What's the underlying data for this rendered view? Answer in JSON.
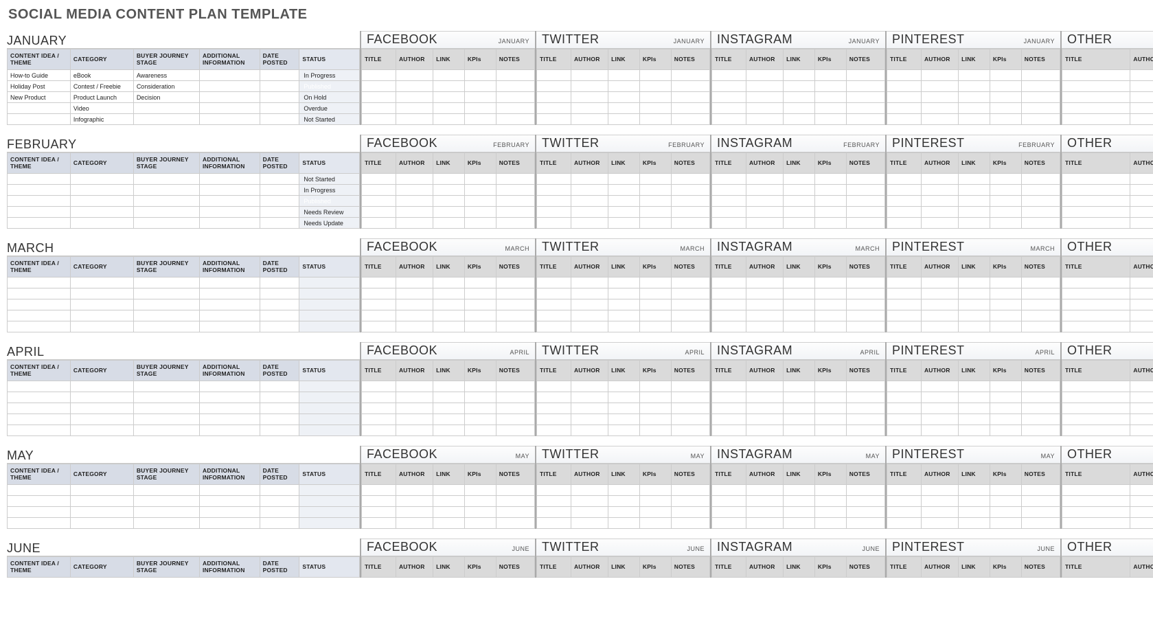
{
  "page_title": "SOCIAL MEDIA CONTENT PLAN TEMPLATE",
  "plan_headers": [
    "CONTENT IDEA / THEME",
    "CATEGORY",
    "BUYER JOURNEY STAGE",
    "ADDITIONAL INFORMATION",
    "DATE POSTED",
    "STATUS"
  ],
  "platform_headers": [
    "TITLE",
    "AUTHOR",
    "LINK",
    "KPIs",
    "NOTES"
  ],
  "platforms": [
    "FACEBOOK",
    "TWITTER",
    "INSTAGRAM",
    "PINTEREST",
    "OTHER"
  ],
  "status_styles": {
    "In Progress": "st-inprogress",
    "Published": "st-published",
    "On Hold": "st-onhold",
    "Overdue": "st-overdue",
    "Not Started": "st-notstarted",
    "Needs Review": "st-needsreview",
    "Needs Update": "st-needsupdate"
  },
  "months": [
    {
      "name": "JANUARY",
      "rows": [
        {
          "idea": "How-to Guide",
          "category": "eBook",
          "stage": "Awareness",
          "info": "",
          "date": "",
          "status": "In Progress"
        },
        {
          "idea": "Holiday Post",
          "category": "Contest / Freebie",
          "stage": "Consideration",
          "info": "",
          "date": "",
          "status": "Published"
        },
        {
          "idea": "New Product",
          "category": "Product Launch",
          "stage": "Decision",
          "info": "",
          "date": "",
          "status": "On Hold"
        },
        {
          "idea": "",
          "category": "Video",
          "stage": "",
          "info": "",
          "date": "",
          "status": "Overdue"
        },
        {
          "idea": "",
          "category": "Infographic",
          "stage": "",
          "info": "",
          "date": "",
          "status": "Not Started"
        }
      ]
    },
    {
      "name": "FEBRUARY",
      "rows": [
        {
          "idea": "",
          "category": "",
          "stage": "",
          "info": "",
          "date": "",
          "status": "Not Started"
        },
        {
          "idea": "",
          "category": "",
          "stage": "",
          "info": "",
          "date": "",
          "status": "In Progress"
        },
        {
          "idea": "",
          "category": "",
          "stage": "",
          "info": "",
          "date": "",
          "status": "Published"
        },
        {
          "idea": "",
          "category": "",
          "stage": "",
          "info": "",
          "date": "",
          "status": "Needs Review"
        },
        {
          "idea": "",
          "category": "",
          "stage": "",
          "info": "",
          "date": "",
          "status": "Needs Update"
        }
      ]
    },
    {
      "name": "MARCH",
      "rows": [
        {
          "idea": "",
          "category": "",
          "stage": "",
          "info": "",
          "date": "",
          "status": ""
        },
        {
          "idea": "",
          "category": "",
          "stage": "",
          "info": "",
          "date": "",
          "status": ""
        },
        {
          "idea": "",
          "category": "",
          "stage": "",
          "info": "",
          "date": "",
          "status": ""
        },
        {
          "idea": "",
          "category": "",
          "stage": "",
          "info": "",
          "date": "",
          "status": ""
        },
        {
          "idea": "",
          "category": "",
          "stage": "",
          "info": "",
          "date": "",
          "status": ""
        }
      ]
    },
    {
      "name": "APRIL",
      "rows": [
        {
          "idea": "",
          "category": "",
          "stage": "",
          "info": "",
          "date": "",
          "status": ""
        },
        {
          "idea": "",
          "category": "",
          "stage": "",
          "info": "",
          "date": "",
          "status": ""
        },
        {
          "idea": "",
          "category": "",
          "stage": "",
          "info": "",
          "date": "",
          "status": ""
        },
        {
          "idea": "",
          "category": "",
          "stage": "",
          "info": "",
          "date": "",
          "status": ""
        },
        {
          "idea": "",
          "category": "",
          "stage": "",
          "info": "",
          "date": "",
          "status": ""
        }
      ]
    },
    {
      "name": "MAY",
      "rows": [
        {
          "idea": "",
          "category": "",
          "stage": "",
          "info": "",
          "date": "",
          "status": ""
        },
        {
          "idea": "",
          "category": "",
          "stage": "",
          "info": "",
          "date": "",
          "status": ""
        },
        {
          "idea": "",
          "category": "",
          "stage": "",
          "info": "",
          "date": "",
          "status": ""
        },
        {
          "idea": "",
          "category": "",
          "stage": "",
          "info": "",
          "date": "",
          "status": ""
        }
      ]
    },
    {
      "name": "JUNE",
      "rows": []
    }
  ]
}
